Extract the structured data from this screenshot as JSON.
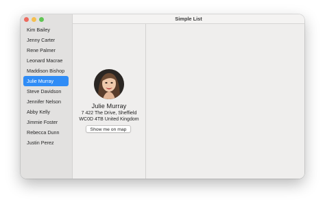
{
  "window": {
    "title": "Simple List"
  },
  "sidebar": {
    "items": [
      {
        "label": "Kim Bailey"
      },
      {
        "label": "Jenny Carter"
      },
      {
        "label": "Rene Palmer"
      },
      {
        "label": "Leonard Macrae"
      },
      {
        "label": "Maddison Bishop"
      },
      {
        "label": "Julie Murray",
        "selected": true
      },
      {
        "label": "Steve Davidson"
      },
      {
        "label": "Jennifer Nelson"
      },
      {
        "label": "Abby Kelly"
      },
      {
        "label": "Jimmie Foster"
      },
      {
        "label": "Rebecca Dunn"
      },
      {
        "label": "Justin Perez"
      }
    ]
  },
  "detail": {
    "avatar_icon": "person-photo-avatar",
    "name": "Julie Murray",
    "address_line1": "7 422 The Drive, Sheffield",
    "address_line2": "WC0D 4TB United Kingdom",
    "map_button_label": "Show me on map"
  },
  "colors": {
    "selection": "#2f8cf6",
    "close": "#ed6a5e",
    "minimize": "#f5bf4f",
    "zoom": "#61c554"
  }
}
